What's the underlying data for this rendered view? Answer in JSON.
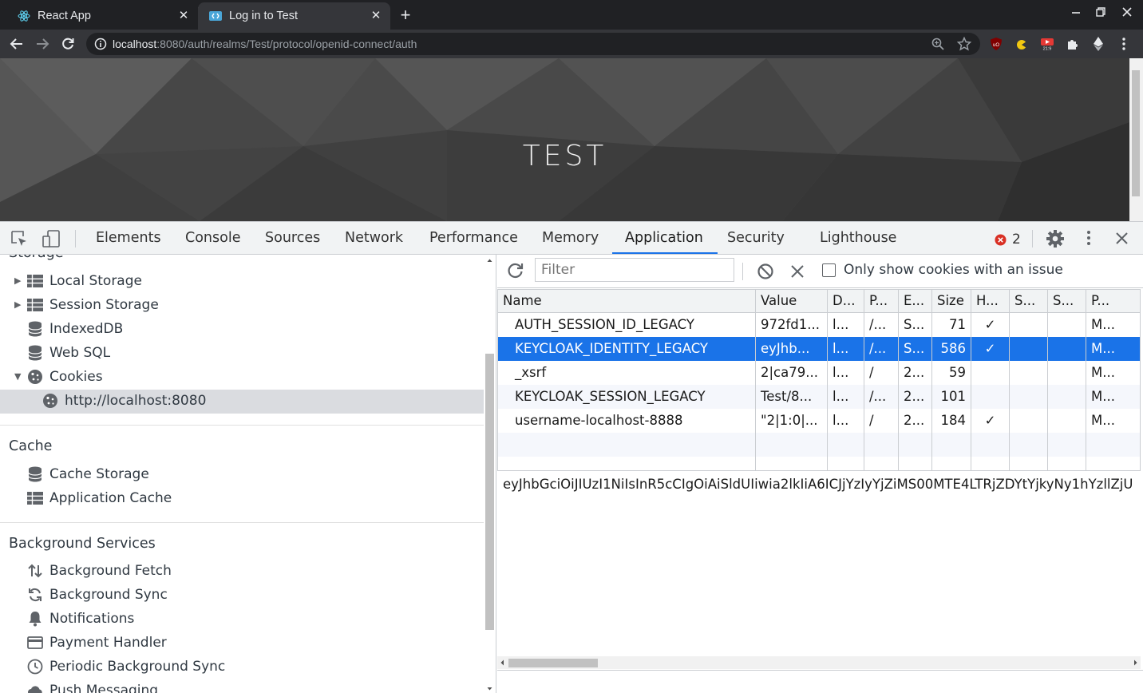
{
  "browser": {
    "tabs": [
      {
        "title": "React App",
        "close": "✕"
      },
      {
        "title": "Log in to Test",
        "close": "✕"
      }
    ],
    "new_tab": "+",
    "address": {
      "host": "localhost",
      "rest": ":8080/auth/realms/Test/protocol/openid-connect/auth"
    }
  },
  "page": {
    "realm_title": "TEST"
  },
  "devtools": {
    "tabs": [
      "Elements",
      "Console",
      "Sources",
      "Network",
      "Performance",
      "Memory",
      "Application",
      "Security",
      "Lighthouse"
    ],
    "active_tab": "Application",
    "error_count": "2"
  },
  "sidebar": {
    "storage_heading_partial": "Storage",
    "storage_items": [
      "Local Storage",
      "Session Storage",
      "IndexedDB",
      "Web SQL",
      "Cookies"
    ],
    "cookie_origin": "http://localhost:8080",
    "cache_heading": "Cache",
    "cache_items": [
      "Cache Storage",
      "Application Cache"
    ],
    "bg_heading": "Background Services",
    "bg_items": [
      "Background Fetch",
      "Background Sync",
      "Notifications",
      "Payment Handler",
      "Periodic Background Sync",
      "Push Messaging"
    ]
  },
  "cookies": {
    "filter_placeholder": "Filter",
    "only_issues_label": "Only show cookies with an issue",
    "columns": [
      "Name",
      "Value",
      "D...",
      "P...",
      "E...",
      "Size",
      "H...",
      "S...",
      "S...",
      "P..."
    ],
    "rows": [
      [
        "AUTH_SESSION_ID_LEGACY",
        "972fd1...",
        "l...",
        "/...",
        "S...",
        "71",
        "✓",
        "",
        "",
        "M..."
      ],
      [
        "KEYCLOAK_IDENTITY_LEGACY",
        "eyJhb...",
        "l...",
        "/...",
        "S...",
        "586",
        "✓",
        "",
        "",
        "M..."
      ],
      [
        "_xsrf",
        "2|ca79...",
        "l...",
        "/",
        "2...",
        "59",
        "",
        "",
        "",
        "M..."
      ],
      [
        "KEYCLOAK_SESSION_LEGACY",
        "Test/8...",
        "l...",
        "/...",
        "2...",
        "101",
        "",
        "",
        "",
        "M..."
      ],
      [
        "username-localhost-8888",
        "\"2|1:0|...",
        "l...",
        "/",
        "2...",
        "184",
        "✓",
        "",
        "",
        "M..."
      ]
    ],
    "selected_row": 1,
    "selected_value": "eyJhbGciOiJIUzI1NiIsInR5cCIgOiAiSldUIiwia2lkIiA6ICJjYzIyYjZiMS00MTE4LTRjZDYtYjkyNy1hYzllZjU"
  },
  "colors": {
    "selection": "#1a73e8",
    "chrome_dark": "#202124",
    "chrome_toolbar": "#35363a"
  }
}
